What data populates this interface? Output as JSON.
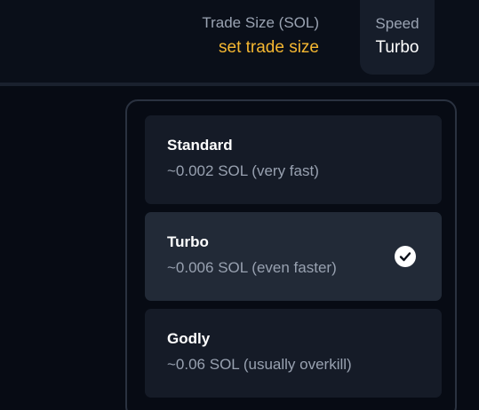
{
  "header": {
    "trade_size_label": "Trade Size (SOL)",
    "trade_size_value": "set trade size",
    "speed_label": "Speed",
    "speed_value": "Turbo"
  },
  "speed_options": [
    {
      "name": "Standard",
      "description": "~0.002 SOL (very fast)",
      "selected": false
    },
    {
      "name": "Turbo",
      "description": "~0.006 SOL (even faster)",
      "selected": true
    },
    {
      "name": "Godly",
      "description": "~0.06 SOL (usually overkill)",
      "selected": false
    }
  ],
  "colors": {
    "accent": "#f5b731",
    "background": "#070b14",
    "option_background": "#151b27",
    "selected_option_background": "#222a37"
  },
  "icons": {
    "selected_indicator": "check-circle-icon"
  }
}
